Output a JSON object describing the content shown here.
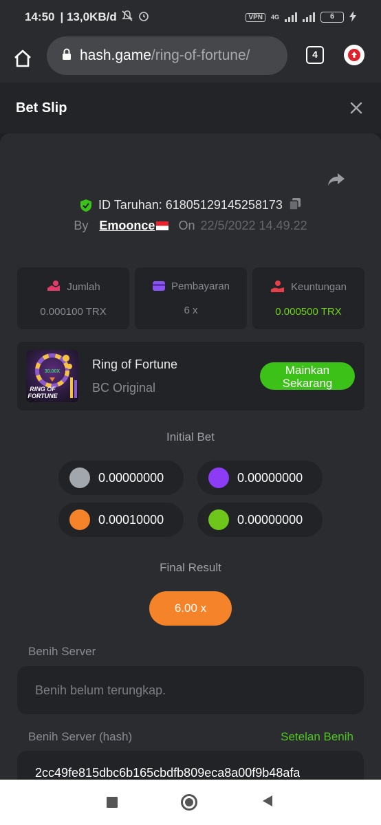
{
  "status": {
    "time": "14:50",
    "net_speed": "| 13,0KB/d",
    "vpn": "VPN",
    "network": "4G",
    "battery": "6"
  },
  "browser": {
    "url_domain": "hash.game",
    "url_path": "/ring-of-fortune/",
    "tab_count": "4"
  },
  "header": {
    "title": "Bet Slip"
  },
  "bet": {
    "id_label": "ID Taruhan: 61805129145258173",
    "by_label": "By",
    "user": "Emoonce",
    "on_label": "On",
    "date": "22/5/2022 14.49.22"
  },
  "stats": [
    {
      "label": "Jumlah",
      "value": "0.000100 TRX",
      "icon": "bet-amount-icon",
      "color": "#e23b67"
    },
    {
      "label": "Pembayaran",
      "value": "6 x",
      "icon": "wallet-icon",
      "color": "#8a52ef"
    },
    {
      "label": "Keuntungan",
      "value": "0.000500 TRX",
      "icon": "profit-hand-icon",
      "color": "#e5414b"
    }
  ],
  "game": {
    "name": "Ring of Fortune",
    "provider": "BC Original",
    "play_label_line1": "Mainkan",
    "play_label_line2": "Sekarang",
    "thumb_multiplier": "30.00X",
    "thumb_title_1": "RING OF",
    "thumb_title_2": "FORTUNE"
  },
  "initial_bet": {
    "label": "Initial Bet",
    "chips": [
      {
        "color": "#a2a7ae",
        "value": "0.00000000"
      },
      {
        "color": "#8c3cf5",
        "value": "0.00000000"
      },
      {
        "color": "#f5832a",
        "value": "0.00010000"
      },
      {
        "color": "#6fc61b",
        "value": "0.00000000"
      }
    ]
  },
  "final_result": {
    "label": "Final Result",
    "value": "6.00 x",
    "color": "#f5832a"
  },
  "seeds": {
    "server_label": "Benih Server",
    "server_placeholder": "Benih belum terungkap.",
    "hash_label": "Benih Server (hash)",
    "settings_link": "Setelan Benih",
    "hash_value": "2cc49fe815dbc6b165cbdfb809eca8a00f9b48afa"
  }
}
